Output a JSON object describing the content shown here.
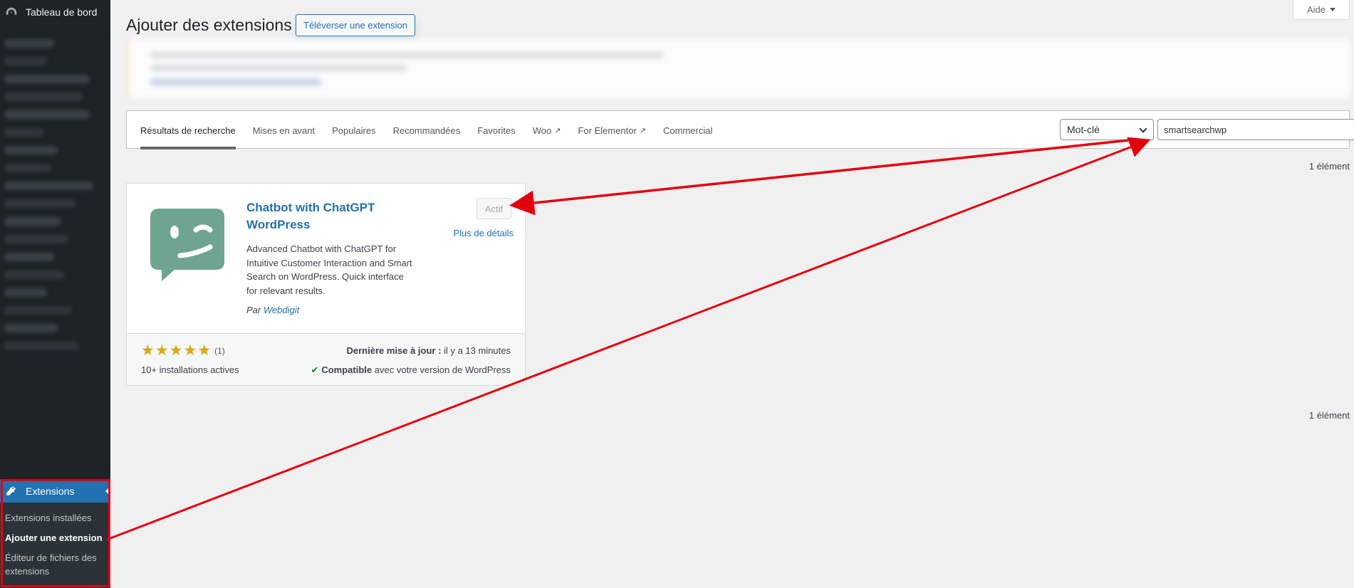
{
  "sidebar": {
    "dashboard_label": "Tableau de bord",
    "extensions_label": "Extensions",
    "submenu": [
      {
        "label": "Extensions installées"
      },
      {
        "label": "Ajouter une extension"
      },
      {
        "label": "Éditeur de fichiers des extensions"
      }
    ]
  },
  "header": {
    "title": "Ajouter des extensions",
    "upload_button": "Téléverser une extension",
    "help_tab": "Aide"
  },
  "filters": {
    "tabs": [
      {
        "label": "Résultats de recherche"
      },
      {
        "label": "Mises en avant"
      },
      {
        "label": "Populaires"
      },
      {
        "label": "Recommandées"
      },
      {
        "label": "Favorites"
      },
      {
        "label": "Woo"
      },
      {
        "label": "For Elementor"
      },
      {
        "label": "Commercial"
      }
    ],
    "search_type": "Mot-clé",
    "search_value": "smartsearchwp"
  },
  "results": {
    "count_top": "1 élément",
    "count_bottom": "1 élément"
  },
  "plugin": {
    "name": "Chatbot with ChatGPT WordPress",
    "action_button": "Actif",
    "more_details": "Plus de détails",
    "description": "Advanced Chatbot with ChatGPT for Intuitive Customer Interaction and Smart Search on WordPress. Quick interface for relevant results.",
    "author_prefix": "Par",
    "author": "Webdigit",
    "rating_count": "(1)",
    "stars": 5,
    "installs": "10+ installations actives",
    "last_updated_label": "Dernière mise à jour :",
    "last_updated_value": "il y a 13 minutes",
    "compat_strong": "Compatible",
    "compat_rest": "avec votre version de WordPress",
    "icon_color": "#6fa58e"
  },
  "colors": {
    "accent": "#2271b1",
    "sidebar_bg": "#1d2327",
    "annotation": "#e3000f",
    "star": "#dba617"
  }
}
